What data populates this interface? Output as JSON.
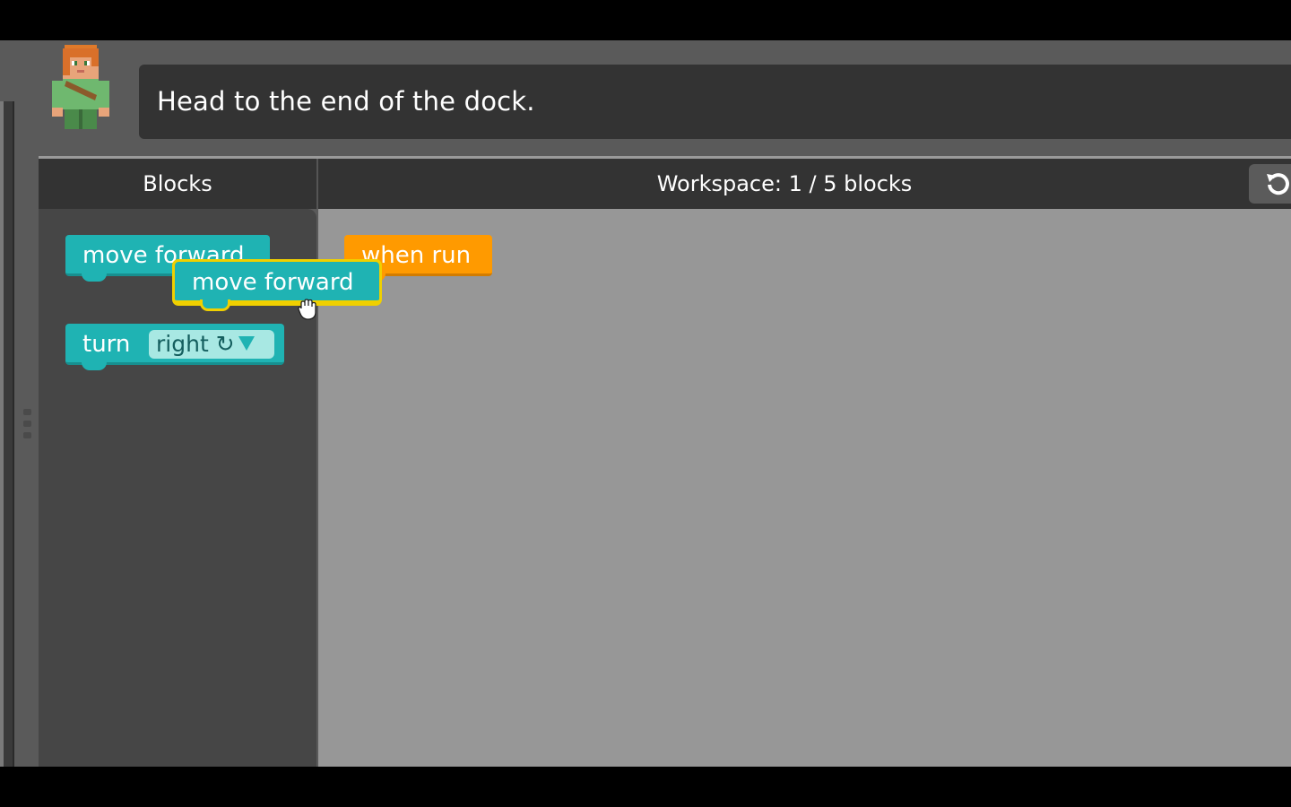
{
  "instruction": {
    "text": "Head to the end of the dock."
  },
  "panels": {
    "blocks_label": "Blocks",
    "workspace_label": "Workspace: 1 / 5 blocks"
  },
  "toolbox": {
    "move_forward_label": "move forward",
    "turn_label": "turn",
    "turn_direction": "right ↻"
  },
  "workspace": {
    "when_run_label": "when run"
  },
  "dragged_block": {
    "label": "move forward"
  },
  "icons": {
    "reset": "reset-icon",
    "avatar": "alex-avatar-icon",
    "cursor": "grab-hand-icon"
  },
  "colors": {
    "motion_block": "#1fb3b3",
    "event_block": "#ff9a00",
    "drag_highlight": "#f0d000"
  }
}
